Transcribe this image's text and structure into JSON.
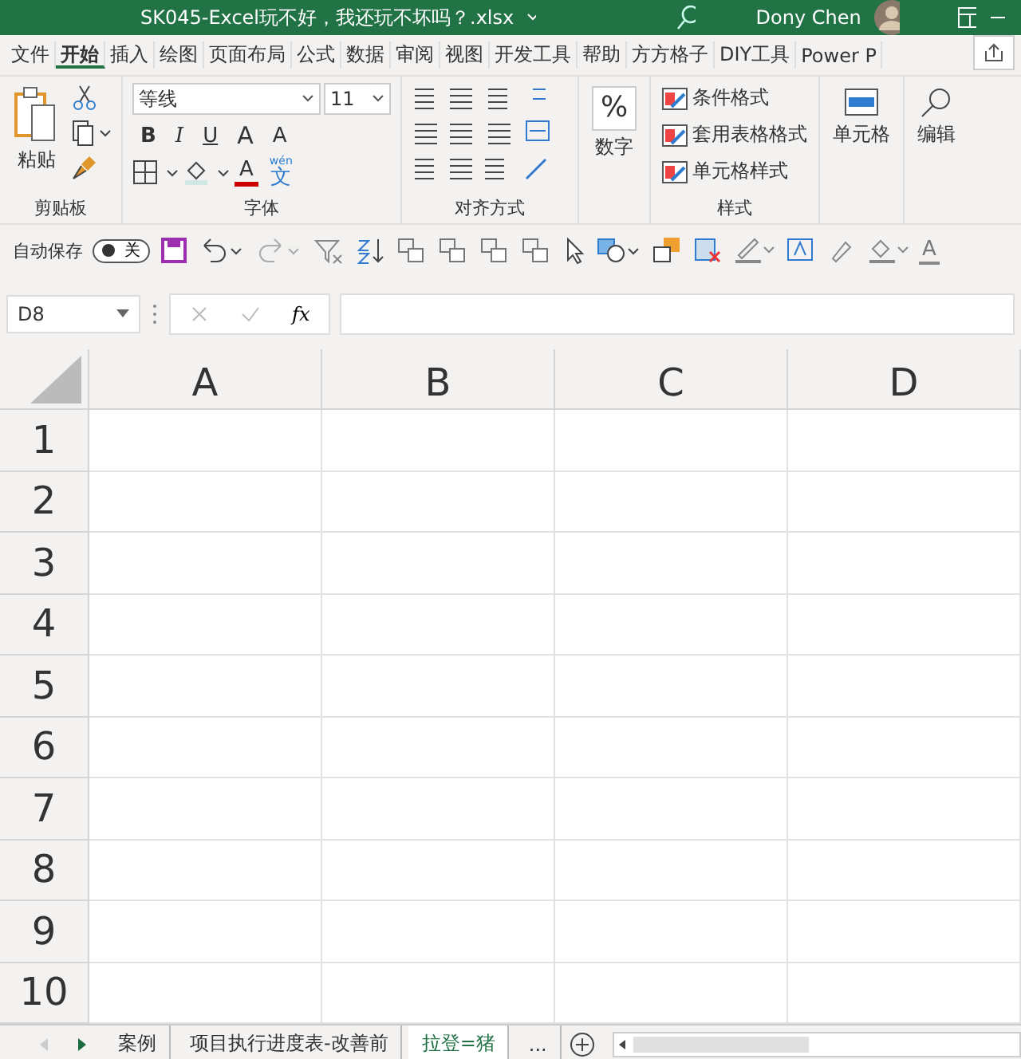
{
  "window": {
    "title": "SK045-Excel玩不好，我还玩不坏吗？.xlsx",
    "user": "Dony Chen"
  },
  "tabs": [
    {
      "label": "文件",
      "selected": false
    },
    {
      "label": "开始",
      "selected": true
    },
    {
      "label": "插入",
      "selected": false
    },
    {
      "label": "绘图",
      "selected": false
    },
    {
      "label": "页面布局",
      "selected": false
    },
    {
      "label": "公式",
      "selected": false
    },
    {
      "label": "数据",
      "selected": false
    },
    {
      "label": "审阅",
      "selected": false
    },
    {
      "label": "视图",
      "selected": false
    },
    {
      "label": "开发工具",
      "selected": false
    },
    {
      "label": "帮助",
      "selected": false
    },
    {
      "label": "方方格子",
      "selected": false
    },
    {
      "label": "DIY工具",
      "selected": false
    },
    {
      "label": "Power P",
      "selected": false
    }
  ],
  "ribbon": {
    "paste": "粘贴",
    "clipboard_label": "剪贴板",
    "font_name": "等线",
    "font_size": "11",
    "bold": "B",
    "italic": "I",
    "underline": "U",
    "grow": "A",
    "shrink": "A",
    "font_color": "A",
    "phonetic_top": "wén",
    "phonetic": "文",
    "font_label": "字体",
    "align_label": "对齐方式",
    "number_symbol": "%",
    "number": "数字",
    "styles": [
      "条件格式",
      "套用表格格式",
      "单元格样式"
    ],
    "styles_label": "样式",
    "cells": "单元格",
    "editing": "编辑"
  },
  "quick_access": {
    "autosave_label": "自动保存",
    "autosave_on": false,
    "autosave_state": "关",
    "font_color": "A"
  },
  "formula_bar": {
    "name_box": "D8",
    "fx": "fx"
  },
  "columns": [
    "A",
    "B",
    "C",
    "D"
  ],
  "rows": [
    "1",
    "2",
    "3",
    "4",
    "5",
    "6",
    "7",
    "8",
    "9",
    "10"
  ],
  "sheet_tabs": [
    {
      "label": "案例",
      "selected": false
    },
    {
      "label": "项目执行进度表-改善前",
      "selected": false
    },
    {
      "label": "拉登=猪",
      "selected": true
    },
    {
      "label": "...",
      "selected": false
    }
  ]
}
